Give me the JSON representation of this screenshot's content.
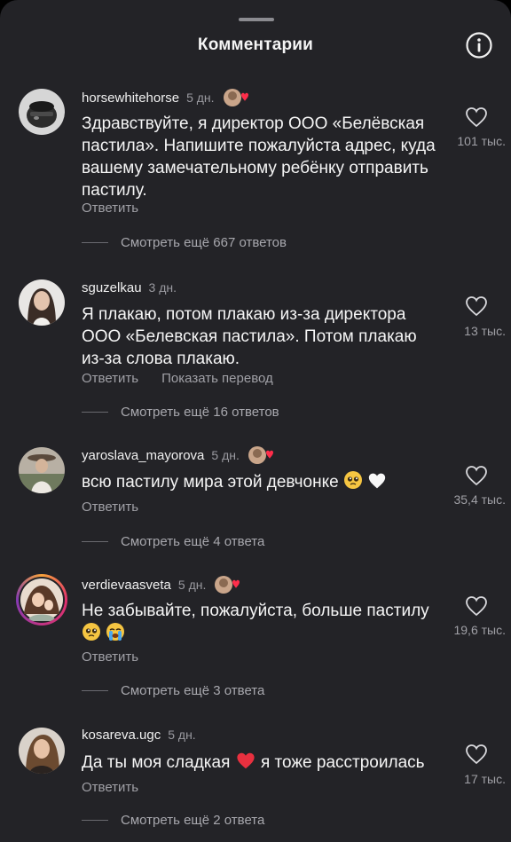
{
  "header": {
    "title": "Комментарии"
  },
  "comments": [
    {
      "username": "horsewhitehorse",
      "time": "5 дн.",
      "text": "Здравствуйте, я директор ООО «Белёвская пастила». Напишите пожалуйста адрес, куда вашему замечательному ребёнку отправить пастилу.",
      "reply_label": "Ответить",
      "likes": "101 тыс.",
      "more_replies": "Смотреть ещё 667 ответов",
      "liked_by_creator": true
    },
    {
      "username": "sguzelkau",
      "time": "3 дн.",
      "text": "Я плакаю, потом плакаю из-за директора ООО «Белевская пастила». Потом плакаю из-за слова плакаю.",
      "reply_label": "Ответить",
      "translate_label": "Показать перевод",
      "likes": "13 тыс.",
      "more_replies": "Смотреть ещё 16 ответов",
      "liked_by_creator": false
    },
    {
      "username": "yaroslava_mayorova",
      "time": "5 дн.",
      "text": "всю пастилу мира этой девчонке",
      "reply_label": "Ответить",
      "likes": "35,4 тыс.",
      "more_replies": "Смотреть ещё 4 ответа",
      "liked_by_creator": true
    },
    {
      "username": "verdievaasveta",
      "time": "5 дн.",
      "text": "Не забывайте, пожалуйста, больше пастилу",
      "reply_label": "Ответить",
      "likes": "19,6 тыс.",
      "more_replies": "Смотреть ещё 3 ответа",
      "liked_by_creator": true
    },
    {
      "username": "kosareva.ugc",
      "time": "5 дн.",
      "text_before": "Да ты моя сладкая",
      "text_after": "я тоже расстроилась",
      "reply_label": "Ответить",
      "likes": "17 тыс.",
      "more_replies": "Смотреть ещё 2 ответа",
      "liked_by_creator": false
    }
  ],
  "colors": {
    "background": "#232327",
    "text": "#f5f5f5",
    "secondary": "#a0a0a6",
    "heart_red": "#ff2d4a"
  },
  "icons": [
    "info-icon",
    "heart-outline-icon",
    "creator-liked-badge",
    "pleading-face-emoji",
    "white-heart-emoji",
    "crying-face-emoji",
    "red-heart-emoji"
  ]
}
